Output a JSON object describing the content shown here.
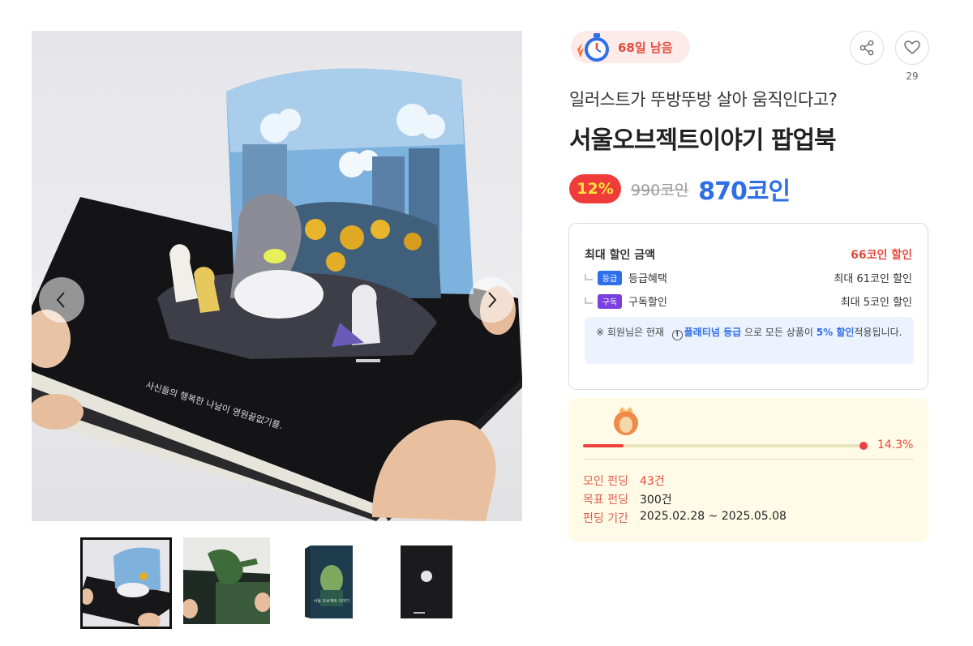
{
  "gallery": {
    "book_text": "사신들의 행복한 나날이 영원끝없기를.",
    "active_index": 0,
    "thumbnail_count": 4,
    "thumb3_cover_title": "서울 오브젝트 이야기"
  },
  "deadline": {
    "label": "68일 남음"
  },
  "like": {
    "count": "29"
  },
  "product": {
    "subtitle": "일러스트가 뚜방뚜방 살아 움직인다고?",
    "title": "서울오브젝트이야기 팝업북"
  },
  "price": {
    "discount_rate": "12%",
    "original": "990코인",
    "final": "870코인",
    "colors": {
      "badge_bg": "#f03b3b",
      "badge_text": "#ffe23d",
      "final": "#2e6fe6"
    }
  },
  "discount": {
    "header_label": "최대 할인 금액",
    "header_value": "66코인 할인",
    "rows": [
      {
        "tag": "등급",
        "label": "등급혜택",
        "value": "최대 61코인 할인"
      },
      {
        "tag": "구독",
        "label": "구독할인",
        "value": "최대 5코인 할인"
      }
    ],
    "notice": {
      "prefix": "※ 회원님은 현재",
      "grade": "플래티넘 등급",
      "middle": "으로 모든 상품이",
      "rate": "5% 할인",
      "suffix": "적용됩니다."
    }
  },
  "funding": {
    "progress_pct": "14.3%",
    "progress_value": 0.143,
    "raised_label": "모인 펀딩",
    "raised_value": "43건",
    "goal_label": "목표 펀딩",
    "goal_value": "300건",
    "period_label": "펀딩 기간",
    "period_value": "2025.02.28 ~ 2025.05.08"
  }
}
